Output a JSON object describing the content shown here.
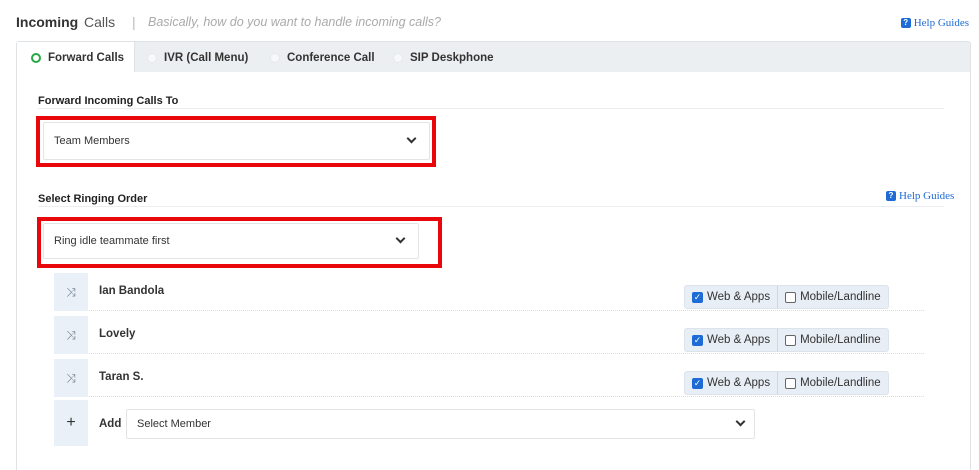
{
  "header": {
    "title_bold": "Incoming",
    "title_rest": "Calls",
    "separator": "|",
    "subtitle": "Basically, how do you want to handle incoming calls?",
    "help": "Help Guides"
  },
  "tabs": [
    {
      "label": "Forward Calls",
      "active": true
    },
    {
      "label": "IVR (Call Menu)",
      "active": false
    },
    {
      "label": "Conference Call",
      "active": false
    },
    {
      "label": "SIP Deskphone",
      "active": false
    }
  ],
  "forward": {
    "label": "Forward Incoming Calls To",
    "selected": "Team Members"
  },
  "ringing": {
    "label": "Select Ringing Order",
    "help": "Help Guides",
    "selected": "Ring idle teammate first"
  },
  "members": [
    {
      "name": "Ian Bandola",
      "web_apps": true,
      "mobile": false
    },
    {
      "name": "Lovely",
      "web_apps": true,
      "mobile": false
    },
    {
      "name": "Taran S.",
      "web_apps": true,
      "mobile": false
    }
  ],
  "options": {
    "web_apps": "Web & Apps",
    "mobile": "Mobile/Landline"
  },
  "add": {
    "label": "Add",
    "placeholder": "Select Member"
  },
  "colors": {
    "highlight": "#e8070a",
    "accent": "#1e6bd6",
    "active_tab_radio": "#28a745"
  }
}
